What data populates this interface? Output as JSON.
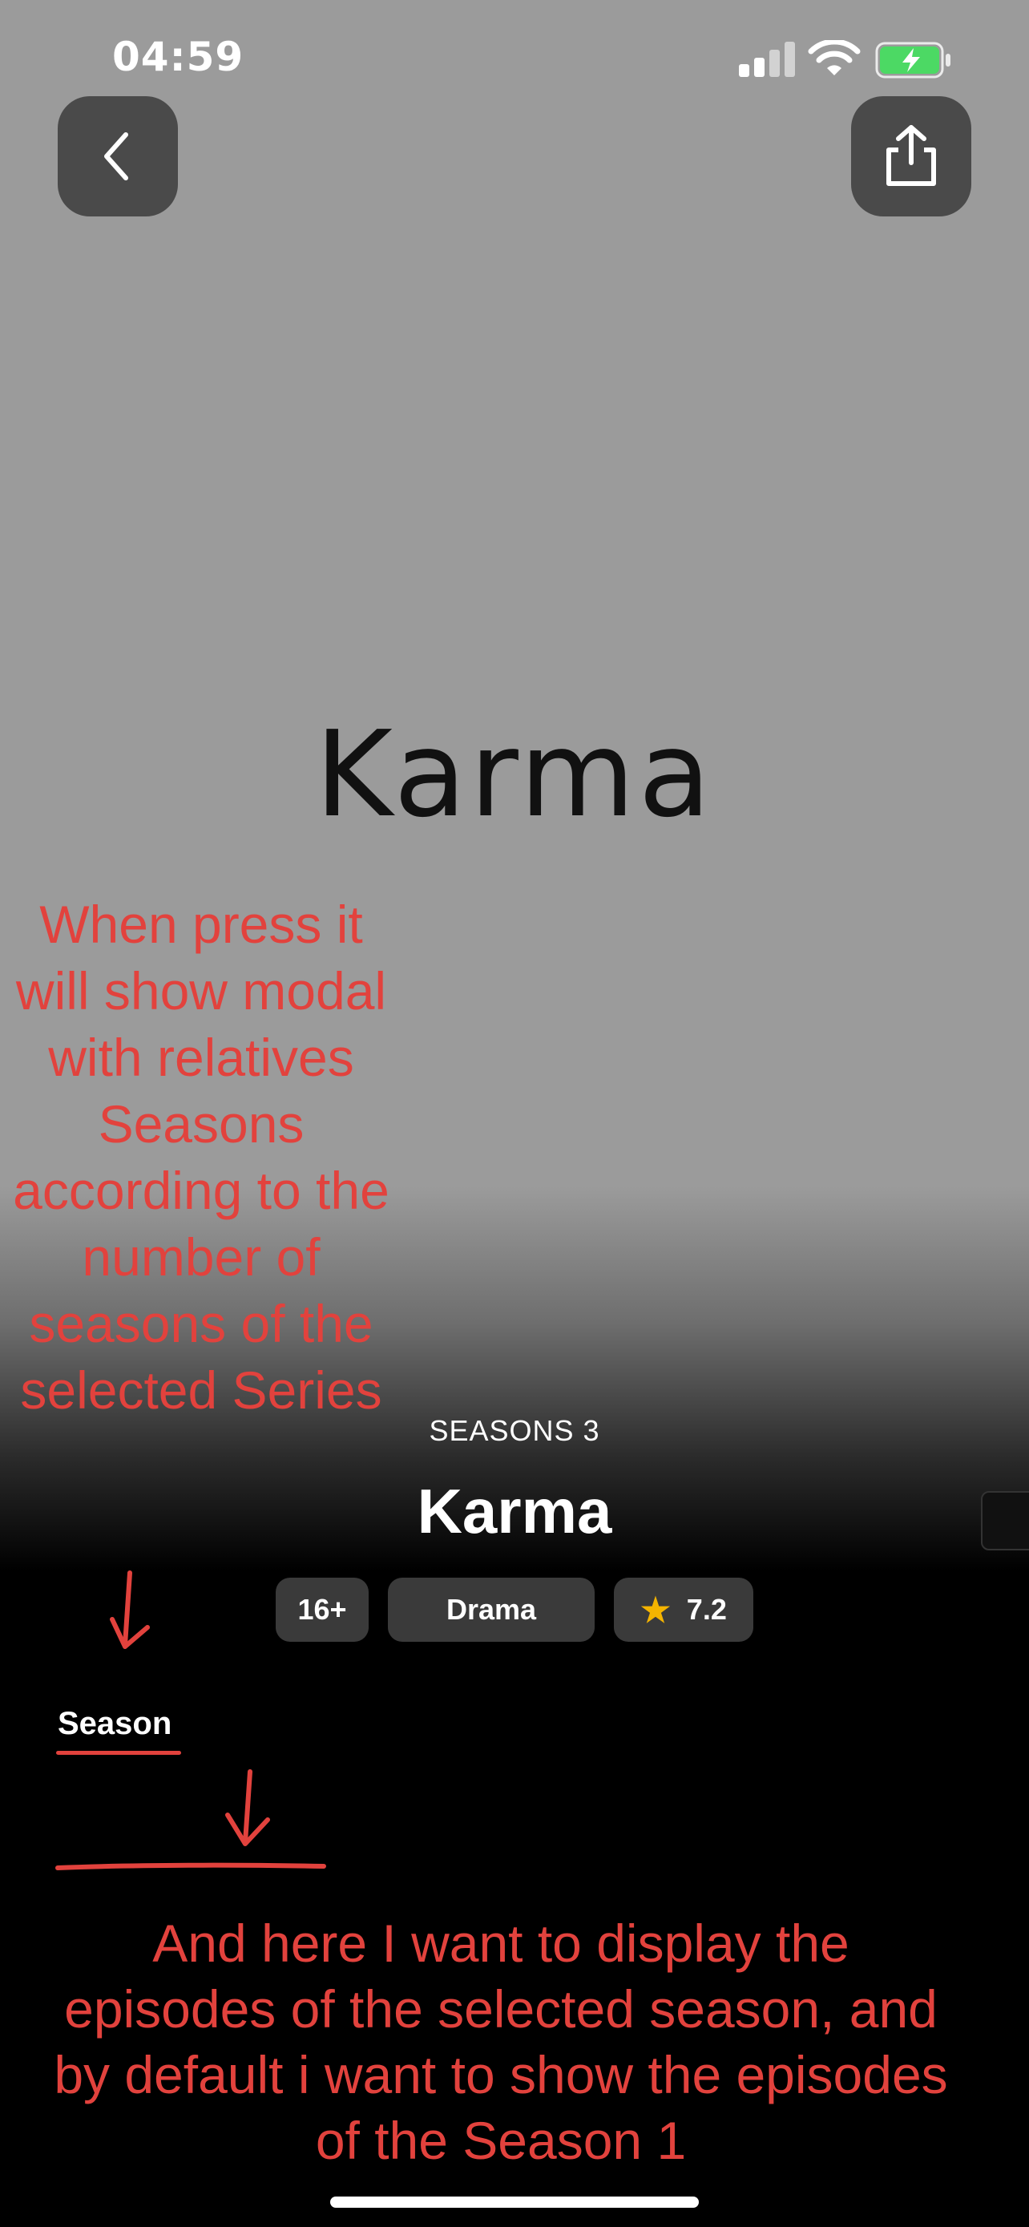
{
  "status_bar": {
    "time": "04:59"
  },
  "header": {
    "back_icon": "chevron-left-icon",
    "share_icon": "share-icon"
  },
  "poster": {
    "title": "Karma"
  },
  "show": {
    "seasons_count": "SEASONS 3",
    "title": "Karma",
    "badges": {
      "age": "16+",
      "genre": "Drama",
      "rating": "7.2",
      "rating_icon": "star-icon"
    }
  },
  "tabs": {
    "season": "Season"
  },
  "annotations": {
    "top_note": "When press it will show modal with relatives Seasons according to the number of seasons of the selected Series",
    "bottom_note": "And here I want to display the episodes of the selected season, and by default i want to show the episodes of the Season 1",
    "color": "#e2423d"
  }
}
